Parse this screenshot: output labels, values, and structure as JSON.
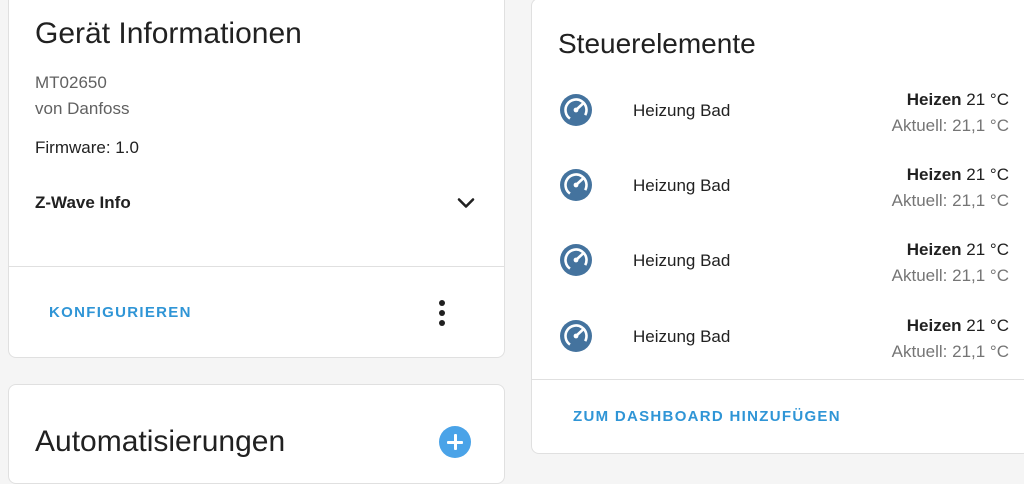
{
  "device_card": {
    "title": "Gerät Informationen",
    "model": "MT02650",
    "manufacturer": "von Danfoss",
    "firmware": "Firmware: 1.0",
    "zwave_label": "Z-Wave Info",
    "configure_label": "KONFIGURIEREN"
  },
  "automations_card": {
    "title": "Automatisierungen"
  },
  "controls_card": {
    "title": "Steuerelemente",
    "entities": [
      {
        "name": "Heizung Bad",
        "mode": "Heizen",
        "target": "21 °C",
        "current": "Aktuell: 21,1 °C"
      },
      {
        "name": "Heizung Bad",
        "mode": "Heizen",
        "target": "21 °C",
        "current": "Aktuell: 21,1 °C"
      },
      {
        "name": "Heizung Bad",
        "mode": "Heizen",
        "target": "21 °C",
        "current": "Aktuell: 21,1 °C"
      },
      {
        "name": "Heizung Bad",
        "mode": "Heizen",
        "target": "21 °C",
        "current": "Aktuell: 21,1 °C"
      }
    ],
    "add_dashboard_label": "ZUM DASHBOARD HINZUFÜGEN"
  },
  "colors": {
    "accent": "#2f95d6",
    "icon": "#44739e",
    "add_button": "#4aa3e8"
  },
  "icons": {
    "expand": "chevron-down-icon",
    "menu": "more-vert-icon",
    "add": "plus-circle-icon",
    "entity": "thermostat-icon"
  }
}
